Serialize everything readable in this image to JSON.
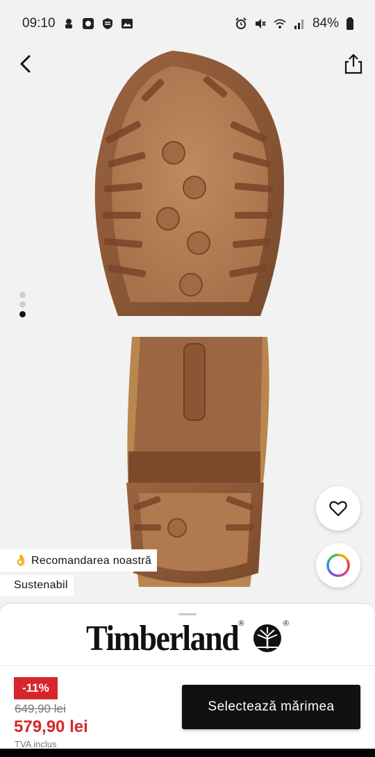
{
  "status_bar": {
    "time": "09:10",
    "battery": "84%"
  },
  "icons": {
    "back": "chevron-left-icon",
    "share": "share-icon",
    "wishlist": "heart-icon",
    "color_picker": "color-wheel-icon",
    "brand_logo": "tree-logo-icon"
  },
  "gallery": {
    "total": 3,
    "active_index": 2
  },
  "tags": {
    "recommendation_emoji": "👌",
    "recommendation": "Recomandarea noastră",
    "sustainable": "Sustenabil"
  },
  "brand": {
    "name": "Timberland",
    "reg_mark": "®"
  },
  "pricing": {
    "discount": "-11%",
    "old_price": "649,90 lei",
    "new_price": "579,90 lei",
    "vat_note": "TVA inclus"
  },
  "actions": {
    "select_size": "Selectează mărimea"
  },
  "colors": {
    "accent_red": "#d7262b",
    "cta_bg": "#111111",
    "sole_outer": "#8a5433",
    "sole_inner": "#b37a52"
  }
}
